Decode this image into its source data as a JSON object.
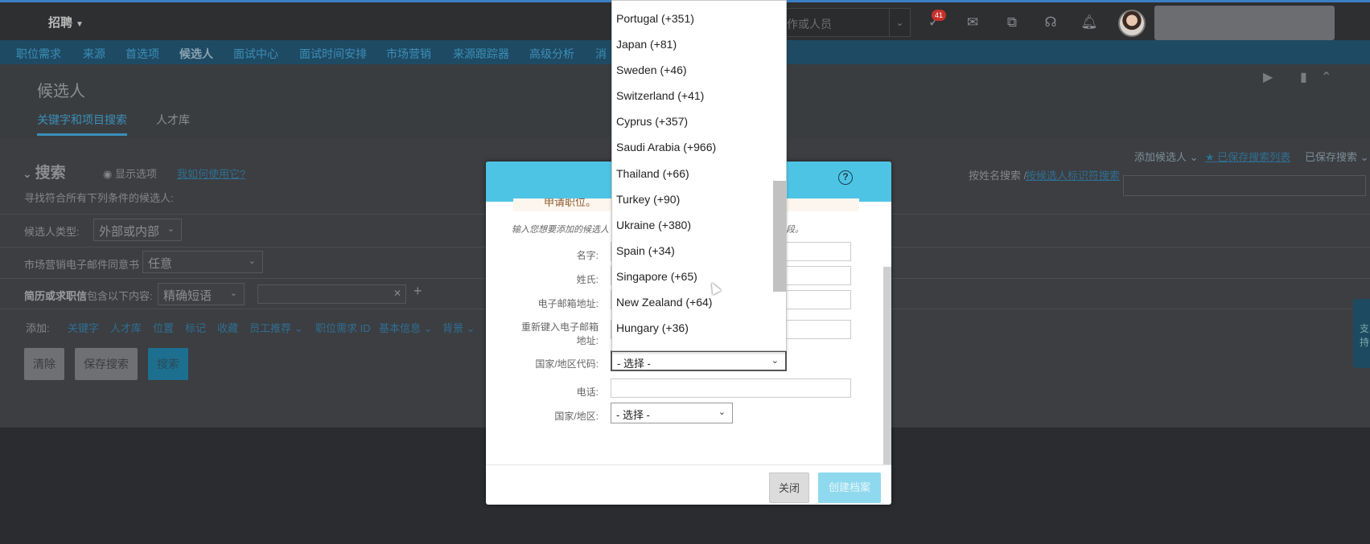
{
  "topbar": {
    "brand": "招聘",
    "search_placeholder": "作或人员",
    "notification_count": "41"
  },
  "nav": {
    "items": [
      "职位需求",
      "来源",
      "首选项",
      "候选人",
      "面试中心",
      "面试时间安排",
      "市场营销",
      "来源跟踪器",
      "高级分析",
      "消"
    ],
    "active": "候选人"
  },
  "header": {
    "title": "候选人",
    "tabs": [
      "关键字和项目搜索",
      "人才库"
    ]
  },
  "search": {
    "heading": "搜索",
    "show_options": "显示选项",
    "how_to": "我如何使用它?",
    "subtitle": "寻找符合所有下列条件的候选人:",
    "add_candidate": "添加候选人",
    "saved_list": "已保存搜索列表",
    "saved_search": "已保存搜索",
    "by_name": "按姓名搜索 /",
    "by_id": "按候选人标识符搜索",
    "candidate_type_label": "候选人类型:",
    "candidate_type_value": "外部或内部",
    "consent_label": "市场营销电子邮件同意书",
    "consent_value": "任意",
    "resume_label_bold": "简历或求职信",
    "resume_label": "包含以下内容:",
    "resume_mode": "精确短语",
    "add_label": "添加:",
    "add_items": [
      "关键字",
      "人才库",
      "位置",
      "标记",
      "收藏",
      "员工推荐",
      "职位需求 ID",
      "基本信息",
      "背景"
    ],
    "buttons": {
      "clear": "清除",
      "save": "保存搜索",
      "search": "搜索"
    },
    "side_tab": "支持"
  },
  "modal": {
    "notice": "申请职位。",
    "hint_left": "输入您想要添加的候选人",
    "hint_right": "字段。",
    "fields": {
      "first_name": "名字:",
      "last_name": "姓氏:",
      "email": "电子邮箱地址:",
      "email_confirm_1": "重新键入电子邮箱",
      "email_confirm_2": "地址:",
      "country_code": "国家/地区代码:",
      "phone": "电话:",
      "country": "国家/地区:"
    },
    "select_placeholder": "- 选择 -",
    "help": "?",
    "buttons": {
      "close": "关闭",
      "create": "创建档案"
    }
  },
  "dropdown": {
    "options": [
      "Portugal (+351)",
      "Japan (+81)",
      "Sweden (+46)",
      "Switzerland (+41)",
      "Cyprus (+357)",
      "Saudi Arabia (+966)",
      "Thailand (+66)",
      "Turkey (+90)",
      "Ukraine (+380)",
      "Spain (+34)",
      "Singapore (+65)",
      "New Zealand (+64)",
      "Hungary (+36)"
    ]
  }
}
